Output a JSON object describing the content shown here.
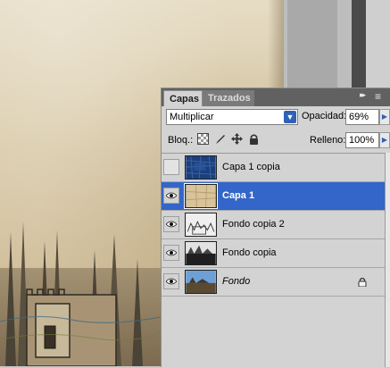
{
  "panel": {
    "tabs": [
      "Capas",
      "Trazados"
    ],
    "menu_arrows": "▸▸",
    "menu_icon": "≡"
  },
  "blend": {
    "value": "Multiplicar"
  },
  "opacity": {
    "label": "Opacidad:",
    "value": "69%"
  },
  "lock": {
    "label": "Bloq.:"
  },
  "fill": {
    "label": "Relleno:",
    "value": "100%"
  },
  "layers": [
    {
      "name": "Capa 1 copia",
      "visible": false,
      "selected": false,
      "thumb": "blue-texture"
    },
    {
      "name": "Capa 1",
      "visible": true,
      "selected": true,
      "thumb": "parchment"
    },
    {
      "name": "Fondo copia 2",
      "visible": true,
      "selected": false,
      "thumb": "sketch"
    },
    {
      "name": "Fondo copia",
      "visible": true,
      "selected": false,
      "thumb": "sketch-dark"
    },
    {
      "name": "Fondo",
      "visible": true,
      "selected": false,
      "thumb": "photo",
      "locked": true,
      "italic": true
    }
  ],
  "colors": {
    "selection": "#3366c8",
    "panel_bg": "#d3d3d3",
    "tab_bar": "#616161"
  }
}
